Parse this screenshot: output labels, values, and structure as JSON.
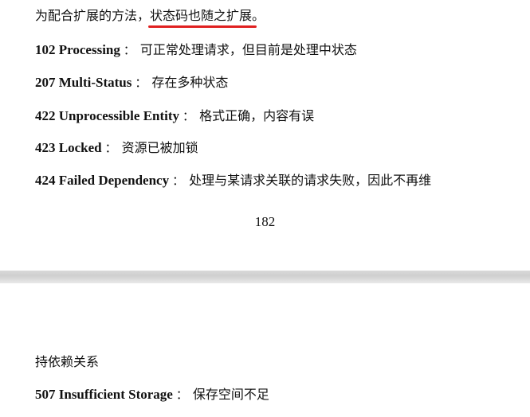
{
  "page_top": {
    "intro_prefix": "为配合扩展的方法，",
    "intro_highlight": "状态码也随之扩展。",
    "entries": [
      {
        "code": "102 Processing",
        "sep": "：",
        "desc": "可正常处理请求，但目前是处理中状态"
      },
      {
        "code": "207 Multi-Status",
        "sep": "：",
        "desc": "存在多种状态"
      },
      {
        "code": "422 Unprocessible Entity",
        "sep": "：",
        "desc": "格式正确，内容有误"
      },
      {
        "code": "423 Locked",
        "sep": "：",
        "desc": "资源已被加锁"
      },
      {
        "code": "424 Failed Dependency",
        "sep": "：",
        "desc": "处理与某请求关联的请求失败，因此不再维"
      }
    ],
    "page_number": "182"
  },
  "page_bottom": {
    "continuation": "持依赖关系",
    "entry": {
      "code": "507 Insufficient Storage",
      "sep": "：",
      "desc": "保存空间不足"
    }
  },
  "colors": {
    "underline": "#e02020",
    "page_gap": "#d4d4d4"
  }
}
